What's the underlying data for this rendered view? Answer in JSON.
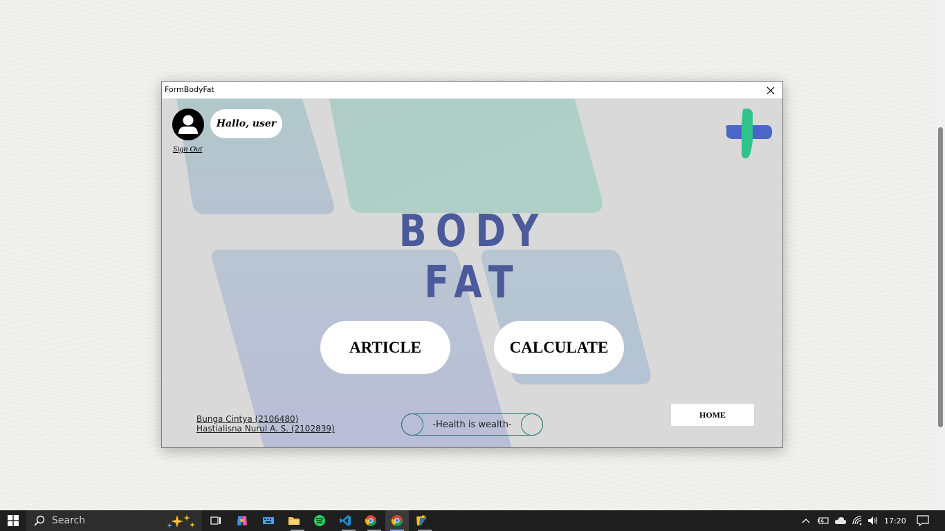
{
  "window": {
    "title": "FormBodyFat"
  },
  "header": {
    "greeting": "Hallo, user",
    "signout_label": "Sign Out"
  },
  "main": {
    "title": "BODY FAT",
    "article_label": "ARTICLE",
    "calculate_label": "CALCULATE"
  },
  "footer": {
    "credits": [
      "Bunga Cintya (2106480)",
      "Hastialisna Nurul A. S. (2102839)"
    ],
    "motto": "-Health is wealth-",
    "home_label": "HOME"
  },
  "taskbar": {
    "search_placeholder": "Search",
    "time": "17:20",
    "apps": [
      "task-view",
      "copilot",
      "keyboard",
      "file-explorer",
      "spotify",
      "vscode",
      "chrome",
      "chrome-active",
      "python-idle"
    ]
  },
  "colors": {
    "title": "#4a5a9a",
    "logo_green": "#2fc38c",
    "logo_blue": "#4a66c8",
    "motto_border": "#257a73",
    "window_bg": "#d9d9d9"
  }
}
